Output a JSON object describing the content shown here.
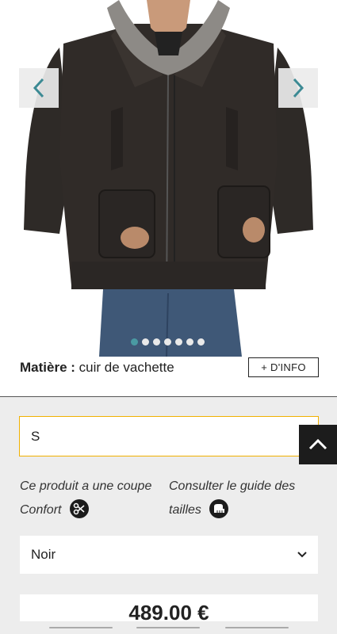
{
  "gallery": {
    "image_icon": "leather-jacket-model-photo",
    "prev_icon": "chevron-left-icon",
    "next_icon": "chevron-right-icon",
    "slide_count": 7,
    "active_slide": 1,
    "accent_color": "#4a9aa3"
  },
  "material": {
    "label": "Matière :",
    "value": "cuir de vachette",
    "info_button": "+ D'INFO"
  },
  "size_select": {
    "value": "S",
    "border_color": "#f0b000"
  },
  "scroll_top_icon": "chevron-up-icon",
  "fit_note": {
    "text": "Ce produit a une coupe Confort",
    "icon": "scissors-icon"
  },
  "size_guide": {
    "text": "Consulter le guide des tailles",
    "icon": "tape-measure-icon"
  },
  "color_select": {
    "value": "Noir",
    "icon": "chevron-down-icon"
  },
  "price": {
    "value": "489.00 €"
  }
}
